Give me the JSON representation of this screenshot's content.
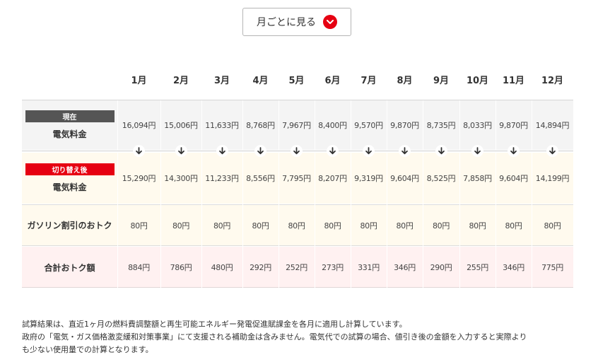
{
  "toggle": {
    "label": "月ごとに見る"
  },
  "months": [
    "1月",
    "2月",
    "3月",
    "4月",
    "5月",
    "6月",
    "7月",
    "8月",
    "9月",
    "10月",
    "11月",
    "12月"
  ],
  "rows": {
    "current": {
      "tag": "現在",
      "label": "電気料金",
      "values": [
        "16,094円",
        "15,006円",
        "11,633円",
        "8,768円",
        "7,967円",
        "8,400円",
        "9,570円",
        "9,870円",
        "8,735円",
        "8,033円",
        "9,870円",
        "14,894円"
      ]
    },
    "switched": {
      "tag": "切り替え後",
      "label": "電気料金",
      "values": [
        "15,290円",
        "14,300円",
        "11,233円",
        "8,556円",
        "7,795円",
        "8,207円",
        "9,319円",
        "9,604円",
        "8,525円",
        "7,858円",
        "9,604円",
        "14,199円"
      ]
    },
    "gasoline": {
      "label": "ガソリン割引のおトク",
      "values": [
        "80円",
        "80円",
        "80円",
        "80円",
        "80円",
        "80円",
        "80円",
        "80円",
        "80円",
        "80円",
        "80円",
        "80円"
      ]
    },
    "total": {
      "label": "合計おトク額",
      "values": [
        "884円",
        "786円",
        "480円",
        "292円",
        "252円",
        "273円",
        "331円",
        "346円",
        "290円",
        "255円",
        "346円",
        "775円"
      ]
    }
  },
  "notes": [
    "試算結果は、直近1ヶ月の燃料費調整額と再生可能エネルギー発電促進賦課金を各月に適用し計算しています。",
    "政府の「電気・ガス価格激変緩和対策事業」にて支援される補助金は含みません。電気代での試算の場合、値引き後の金額を入力すると実際より",
    "も少ない使用量での計算となります。"
  ],
  "colors": {
    "accent": "#e60012",
    "current_band": "#f4f4f4",
    "switch_band": "#fffaee",
    "total_band": "#fff1f1"
  }
}
